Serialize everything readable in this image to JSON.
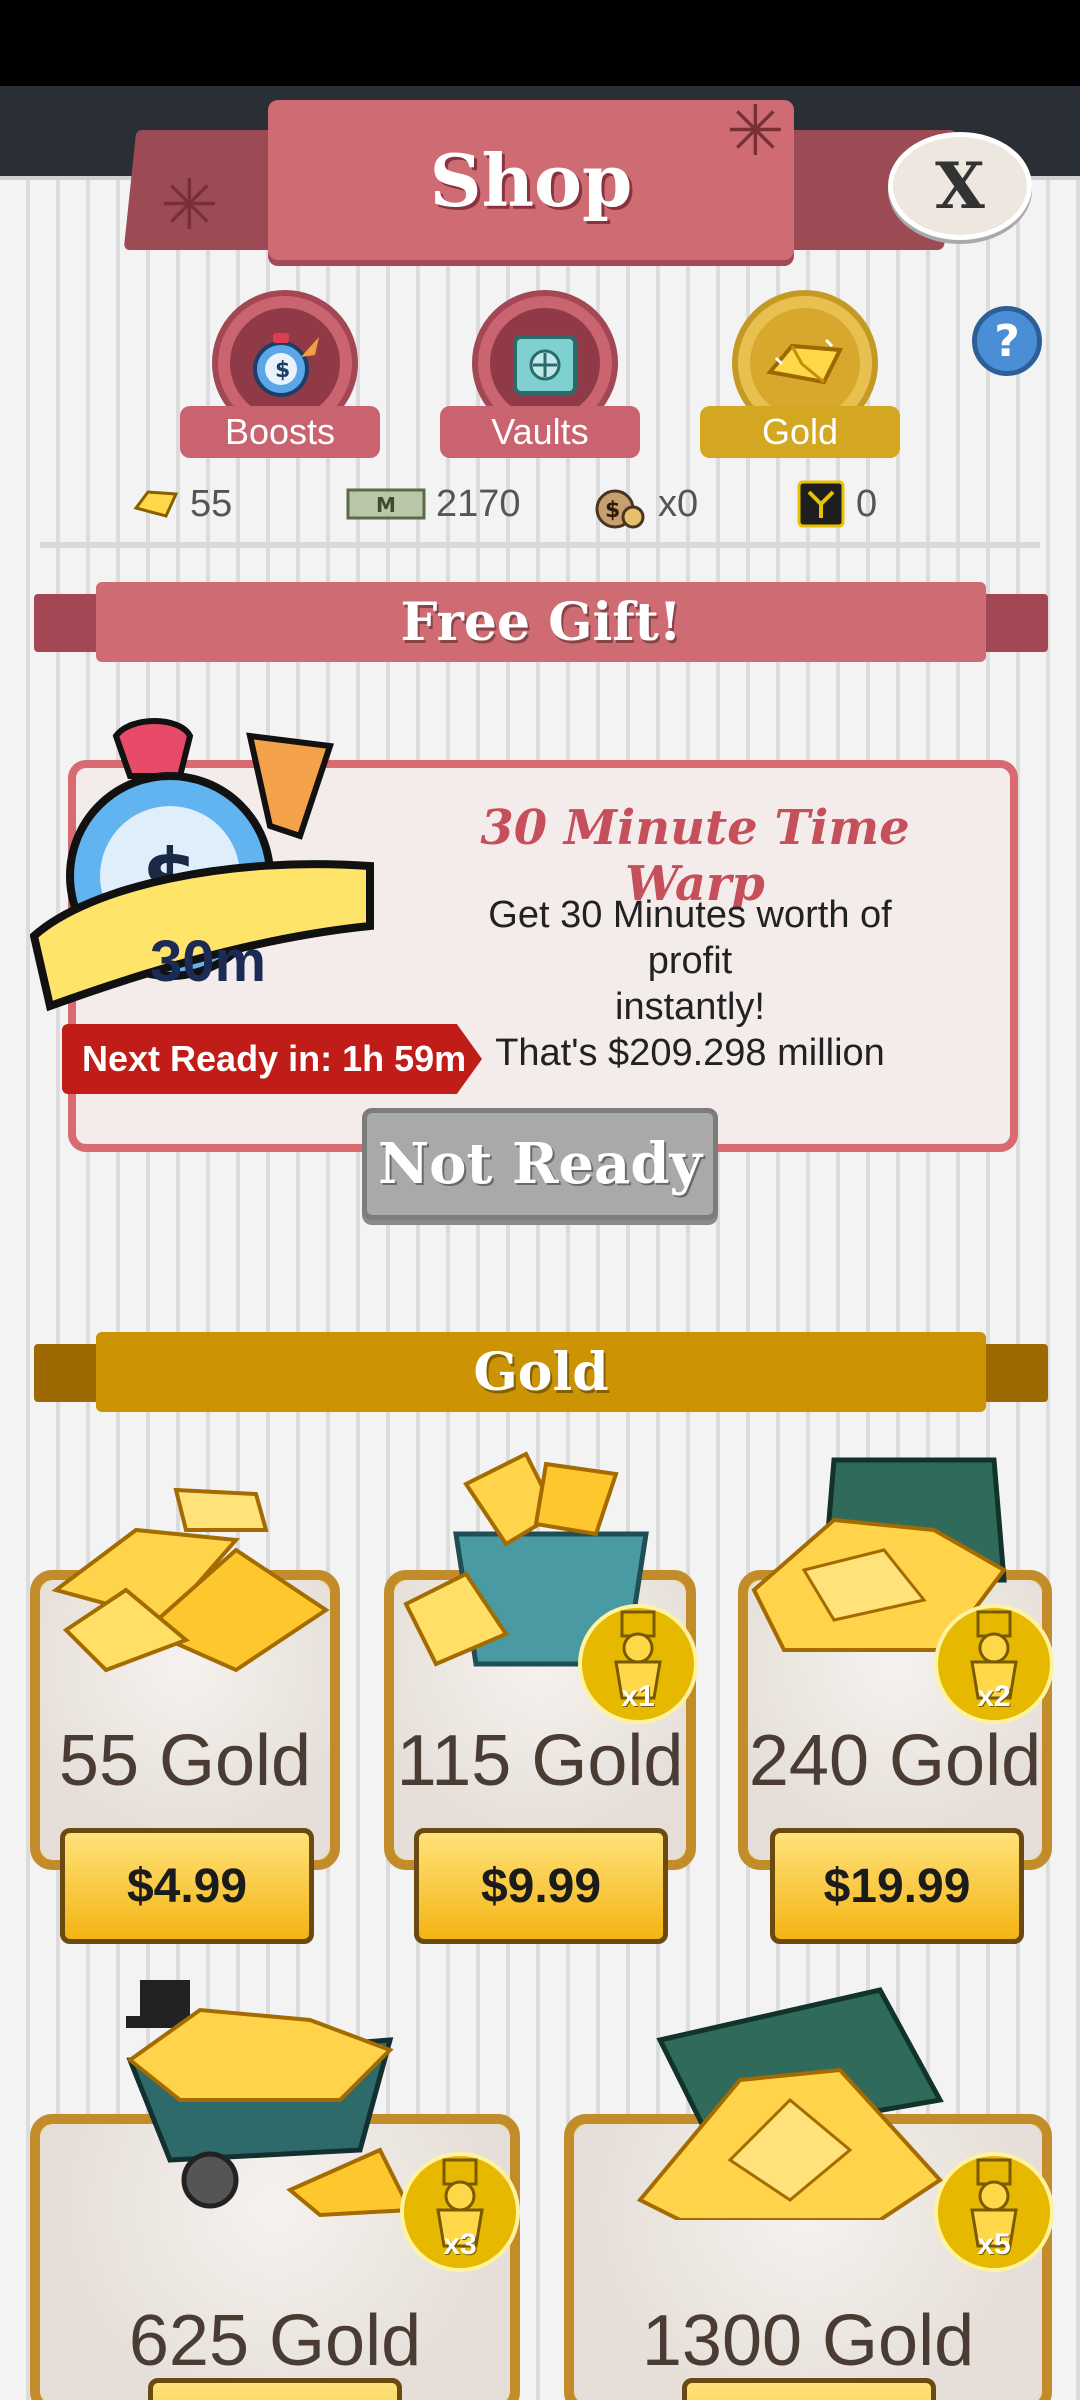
{
  "header": {
    "title": "Shop",
    "close_label": "X",
    "help_label": "?"
  },
  "tabs": [
    {
      "label": "Boosts",
      "icon": "boost-stopwatch-icon",
      "active": false
    },
    {
      "label": "Vaults",
      "icon": "vault-icon",
      "active": false
    },
    {
      "label": "Gold",
      "icon": "gold-bar-icon",
      "active": true
    }
  ],
  "currencies": [
    {
      "icon": "gold-icon",
      "value": "55"
    },
    {
      "icon": "megabucks-icon",
      "value": "2170"
    },
    {
      "icon": "money-bag-icon",
      "value": "x0"
    },
    {
      "icon": "mega-ticket-icon",
      "value": "0"
    }
  ],
  "free_gift": {
    "section_title": "Free Gift!",
    "item_title": "30 Minute Time Warp",
    "badge": "30m",
    "desc_line1": "Get 30 Minutes worth of profit",
    "desc_line2": "instantly!",
    "desc_line3": "That's $209.298 million",
    "timer": "Next Ready in: 1h 59m",
    "button_label": "Not Ready"
  },
  "gold_section": {
    "title": "Gold",
    "packs": [
      {
        "name": "55 Gold",
        "price": "$4.99",
        "multiplier": ""
      },
      {
        "name": "115 Gold",
        "price": "$9.99",
        "multiplier": "x1"
      },
      {
        "name": "240 Gold",
        "price": "$19.99",
        "multiplier": "x2"
      },
      {
        "name": "625 Gold",
        "price": "",
        "multiplier": "x3"
      },
      {
        "name": "1300 Gold",
        "price": "",
        "multiplier": "x5"
      }
    ]
  },
  "colors": {
    "accent_red": "#cf6b72",
    "gold": "#d4a722",
    "panel": "#efefef",
    "timer_red": "#c01c18"
  }
}
